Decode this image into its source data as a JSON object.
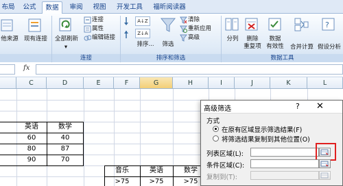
{
  "ribbon": {
    "tabs": [
      "布局",
      "公式",
      "数据",
      "审阅",
      "视图",
      "开发工具",
      "福昕阅读器"
    ],
    "active_tab": "数据",
    "groups": {
      "external": {
        "label": ""
      },
      "connections": {
        "label": "连接"
      },
      "sort_filter": {
        "label": "排序和筛选"
      },
      "data_tools": {
        "label": "数据工具"
      }
    },
    "buttons": {
      "other_sources": "他来源",
      "existing_connections": "现有连接",
      "refresh_all": "全部刷新",
      "connections": "连接",
      "properties": "属性",
      "edit_links": "编辑链接",
      "sort": "排序...",
      "filter": "筛选",
      "clear": "清除",
      "reapply": "重新应用",
      "advanced": "高级",
      "text_to_columns": "分列",
      "remove_duplicates_1": "删除",
      "remove_duplicates_2": "重复项",
      "data_validation_1": "数据",
      "data_validation_2": "有效性",
      "consolidate": "合并计算",
      "what_if": "假设分析"
    },
    "sort_az": "A↓Z",
    "sort_za": "Z↓A"
  },
  "formula_bar": {
    "fx": "fx",
    "value": ""
  },
  "columns": [
    "C",
    "D",
    "E",
    "F",
    "G",
    "H",
    "I",
    "J",
    "K",
    "L"
  ],
  "selected_column": "G",
  "table1": {
    "headers": [
      "英语",
      "数学"
    ],
    "rows": [
      [
        "60",
        "40"
      ],
      [
        "80",
        "87"
      ],
      [
        "90",
        "70"
      ]
    ]
  },
  "criteria": {
    "headers": [
      "音乐",
      "英语",
      "数学"
    ],
    "values": [
      ">75",
      ">75",
      ">75"
    ]
  },
  "dialog": {
    "title": "高级筛选",
    "help": "?",
    "close": "✕",
    "mode_label": "方式",
    "option_inplace": "在原有区域显示筛选结果(F)",
    "option_copy": "将筛选结果复制到其他位置(O)",
    "list_range_label": "列表区域(L):",
    "criteria_range_label": "条件区域(C):",
    "copy_to_label": "复制到(T):",
    "list_range_value": "",
    "criteria_range_value": "",
    "copy_to_value": ""
  }
}
